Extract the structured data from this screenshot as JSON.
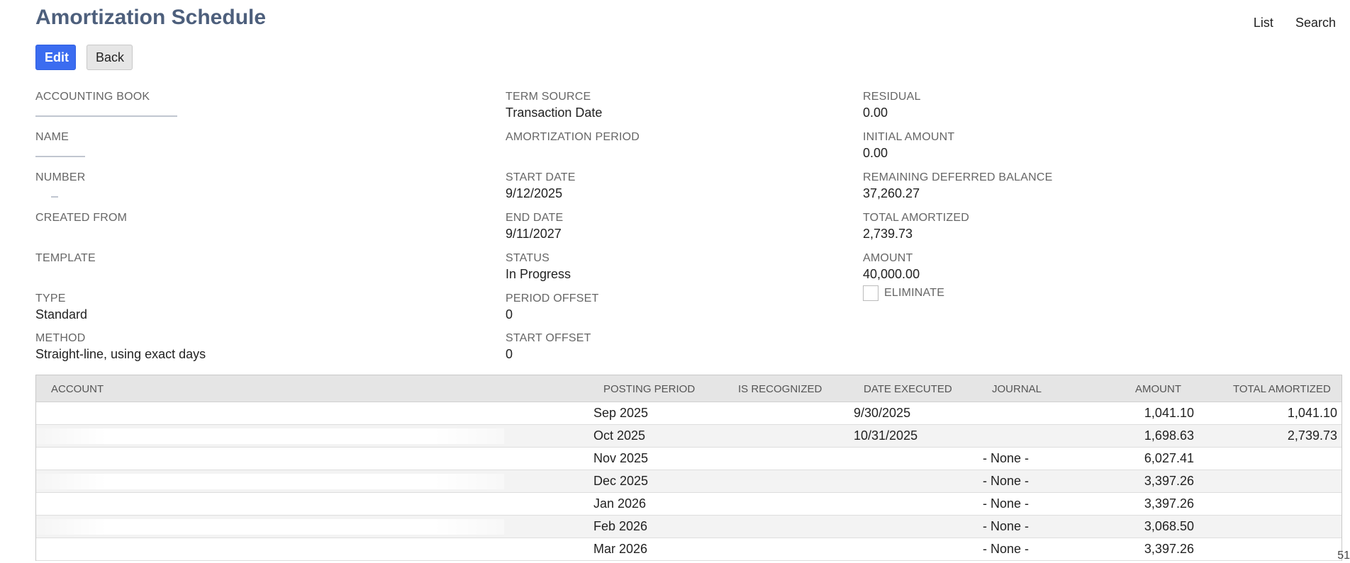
{
  "page": {
    "title": "Amortization Schedule",
    "links": [
      "List",
      "Search"
    ],
    "buttons": {
      "edit": "Edit",
      "back": "Back"
    }
  },
  "fields": {
    "accounting_book": {
      "label": "ACCOUNTING BOOK",
      "value": ""
    },
    "name": {
      "label": "NAME",
      "value": ""
    },
    "number": {
      "label": "NUMBER",
      "value": ""
    },
    "created_from": {
      "label": "CREATED FROM",
      "value": ""
    },
    "template": {
      "label": "TEMPLATE",
      "value": ""
    },
    "type": {
      "label": "TYPE",
      "value": "Standard"
    },
    "method": {
      "label": "METHOD",
      "value": "Straight-line, using exact days"
    },
    "term_source": {
      "label": "TERM SOURCE",
      "value": "Transaction Date"
    },
    "amortization_period": {
      "label": "AMORTIZATION PERIOD",
      "value": ""
    },
    "start_date": {
      "label": "START DATE",
      "value": "9/12/2025"
    },
    "end_date": {
      "label": "END DATE",
      "value": "9/11/2027"
    },
    "status": {
      "label": "STATUS",
      "value": "In Progress"
    },
    "period_offset": {
      "label": "PERIOD OFFSET",
      "value": "0"
    },
    "start_offset": {
      "label": "START OFFSET",
      "value": "0"
    },
    "residual": {
      "label": "RESIDUAL",
      "value": "0.00"
    },
    "initial_amount": {
      "label": "INITIAL AMOUNT",
      "value": "0.00"
    },
    "remaining_deferred_balance": {
      "label": "REMAINING DEFERRED BALANCE",
      "value": "37,260.27"
    },
    "total_amortized": {
      "label": "TOTAL AMORTIZED",
      "value": "2,739.73"
    },
    "amount": {
      "label": "AMOUNT",
      "value": "40,000.00"
    },
    "eliminate": {
      "label": "ELIMINATE",
      "checked": false
    }
  },
  "table": {
    "headers": {
      "account": "ACCOUNT",
      "posting_period": "POSTING PERIOD",
      "is_recognized": "IS RECOGNIZED",
      "date_executed": "DATE EXECUTED",
      "journal": "JOURNAL",
      "amount": "AMOUNT",
      "total_amortized": "TOTAL AMORTIZED"
    },
    "rows": [
      {
        "posting_period": "Sep 2025",
        "date_executed": "9/30/2025",
        "journal": "",
        "amount": "1,041.10",
        "total_amortized": "1,041.10"
      },
      {
        "posting_period": "Oct 2025",
        "date_executed": "10/31/2025",
        "journal": "",
        "amount": "1,698.63",
        "total_amortized": "2,739.73"
      },
      {
        "posting_period": "Nov 2025",
        "date_executed": "",
        "journal": "- None -",
        "amount": "6,027.41",
        "total_amortized": ""
      },
      {
        "posting_period": "Dec 2025",
        "date_executed": "",
        "journal": "- None -",
        "amount": "3,397.26",
        "total_amortized": ""
      },
      {
        "posting_period": "Jan 2026",
        "date_executed": "",
        "journal": "- None -",
        "amount": "3,397.26",
        "total_amortized": ""
      },
      {
        "posting_period": "Feb 2026",
        "date_executed": "",
        "journal": "- None -",
        "amount": "3,068.50",
        "total_amortized": ""
      },
      {
        "posting_period": "Mar 2026",
        "date_executed": "",
        "journal": "- None -",
        "amount": "3,397.26",
        "total_amortized": ""
      }
    ]
  },
  "edge_text": "51"
}
